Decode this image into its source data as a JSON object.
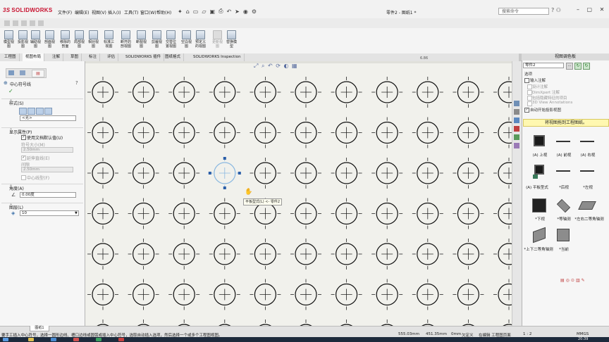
{
  "app": {
    "logo": "SOLIDWORKS",
    "doc_title": "零件2 - 图纸1 *",
    "search_placeholder": "搜索命令"
  },
  "menu": [
    "文件(F)",
    "编辑(E)",
    "视图(V)",
    "插入(I)",
    "工具(T)",
    "窗口(W)",
    "帮助(H)"
  ],
  "ribbon": [
    {
      "label": "模型视图",
      "disabled": false
    },
    {
      "label": "投影视图",
      "disabled": false
    },
    {
      "label": "辅助视图",
      "disabled": false
    },
    {
      "label": "剖面视图",
      "disabled": false
    },
    {
      "label": "移除的剖面",
      "disabled": false
    },
    {
      "label": "局部视图",
      "disabled": false
    },
    {
      "label": "相对视图",
      "disabled": false
    },
    {
      "label": "标准三视图",
      "disabled": false
    },
    {
      "label": "断开的剖视图",
      "disabled": false
    },
    {
      "label": "断裂视图",
      "disabled": false
    },
    {
      "label": "剪裁视图",
      "disabled": false
    },
    {
      "label": "交替位置视图",
      "disabled": false
    },
    {
      "label": "空白视图",
      "disabled": false
    },
    {
      "label": "预定义的视图",
      "disabled": false
    },
    {
      "label": "更新视图",
      "disabled": true
    },
    {
      "label": "替换模型",
      "disabled": false
    }
  ],
  "tabs": [
    "工程图",
    "视图布局",
    "注解",
    "草图",
    "标注",
    "评估",
    "SOLIDWORKS 插件",
    "图纸格式",
    "SOLIDWORKS Inspection"
  ],
  "active_tab": 1,
  "ruler_label": "6.86",
  "property_manager": {
    "title": "中心符号线",
    "ok": "✓",
    "style_section": "样式(S)",
    "style_value": "<无>",
    "display_section": "显示属性(P)",
    "use_doc_defaults": "使用文档默认值(U)",
    "mark_size_label": "符号大小(M)",
    "mark_size_value": "2.50mm",
    "extended_lines": "延伸直线(E)",
    "gap_label": "间隙",
    "gap_value": "2.50mm",
    "centerline_font": "中心线型(F)",
    "angle_section": "角度(A)",
    "angle_value": "0.00度",
    "layer_section": "图层(L)",
    "layer_value": "10"
  },
  "canvas": {
    "tooltip": "平板型式(L) <- 零件2"
  },
  "view_palette": {
    "title": "视图调色板",
    "part": "零件2",
    "options_label": "选项",
    "import_annotations": "输入注解",
    "design_annotations": "设计注解",
    "dimxpert_annotations": "DimXpert 注解",
    "hidden_features": "包括隐藏特征的项目",
    "3d_annotations": "3D View Annotations",
    "auto_projection": "自动开始投影视图",
    "drag_hint": "将视图拖到工程图纸。",
    "views": [
      "(A) 上视",
      "(A) 前视",
      "(A) 右视",
      "(A) 平板型式",
      "*后视",
      "*左视",
      "*下视",
      "*等轴测",
      "*左右二等角轴测",
      "*上下二等角轴测",
      "*当前"
    ]
  },
  "status": {
    "hint": "要手工插入中心符号，选择一圆形边线、槽口边线或圆弧或插入中心符号，选取自动插入选项，然后选择一个或多个工程图视图。",
    "sheet_tab": "图纸1",
    "x": "555.03mm",
    "y": "451.35mm",
    "z": "0mm",
    "state": "欠定义",
    "mode": "在编辑 工程图页面",
    "scale": "1 : 2",
    "units": "MMGS"
  },
  "taskbar": {
    "time": "20:39"
  }
}
